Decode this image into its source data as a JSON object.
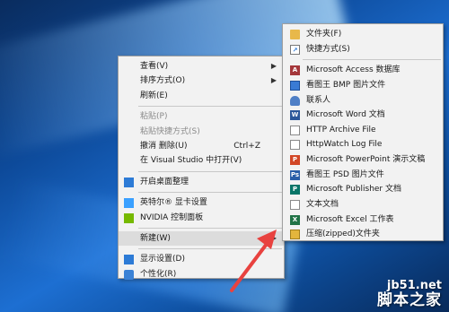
{
  "context_menu": {
    "items": [
      {
        "label": "查看(V)",
        "has_submenu": true
      },
      {
        "label": "排序方式(O)",
        "has_submenu": true
      },
      {
        "label": "刷新(E)"
      },
      {
        "label": "粘贴(P)",
        "disabled": true
      },
      {
        "label": "粘贴快捷方式(S)",
        "disabled": true
      },
      {
        "label": "撤消 删除(U)",
        "shortcut": "Ctrl+Z"
      },
      {
        "label": "在 Visual Studio 中打开(V)"
      },
      {
        "label": "开启桌面整理",
        "icon": "desktop-organize-icon"
      },
      {
        "label": "英特尔® 显卡设置",
        "icon": "intel-graphics-icon"
      },
      {
        "label": "NVIDIA 控制面板",
        "icon": "nvidia-icon"
      },
      {
        "label": "新建(W)",
        "has_submenu": true,
        "highlighted": true
      },
      {
        "label": "显示设置(D)",
        "icon": "display-icon"
      },
      {
        "label": "个性化(R)",
        "icon": "personalize-icon"
      }
    ]
  },
  "new_submenu": {
    "items": [
      {
        "label": "文件夹(F)",
        "icon": "folder-icon"
      },
      {
        "label": "快捷方式(S)",
        "icon": "shortcut-icon"
      },
      {
        "label": "Microsoft Access 数据库",
        "icon": "access-icon"
      },
      {
        "label": "看图王 BMP 图片文件",
        "icon": "bmp-icon"
      },
      {
        "label": "联系人",
        "icon": "contact-icon"
      },
      {
        "label": "Microsoft Word 文档",
        "icon": "word-icon"
      },
      {
        "label": "HTTP Archive File",
        "icon": "document-icon"
      },
      {
        "label": "HttpWatch Log File",
        "icon": "document-icon"
      },
      {
        "label": "Microsoft PowerPoint 演示文稿",
        "icon": "powerpoint-icon"
      },
      {
        "label": "看图王 PSD 图片文件",
        "icon": "psd-icon"
      },
      {
        "label": "Microsoft Publisher 文档",
        "icon": "publisher-icon"
      },
      {
        "label": "文本文档",
        "icon": "text-document-icon"
      },
      {
        "label": "Microsoft Excel 工作表",
        "icon": "excel-icon"
      },
      {
        "label": "压缩(zipped)文件夹",
        "icon": "zip-folder-icon"
      }
    ]
  },
  "watermark": {
    "line1": "jb51.net",
    "line2": "脚本之家"
  },
  "colors": {
    "arrow": "#e8423f",
    "menu_bg": "#f2f2f2",
    "highlight": "#dcdcdc"
  }
}
